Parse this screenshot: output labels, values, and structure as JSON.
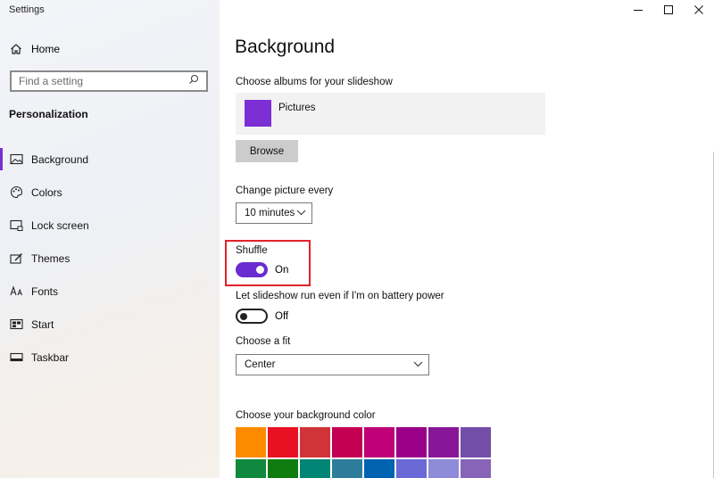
{
  "window": {
    "title": "Settings"
  },
  "sidebar": {
    "home_label": "Home",
    "search_placeholder": "Find a setting",
    "section": "Personalization",
    "items": [
      {
        "label": "Background",
        "icon": "image-icon",
        "active": true
      },
      {
        "label": "Colors",
        "icon": "palette-icon"
      },
      {
        "label": "Lock screen",
        "icon": "lock-screen-icon"
      },
      {
        "label": "Themes",
        "icon": "themes-icon"
      },
      {
        "label": "Fonts",
        "icon": "fonts-icon"
      },
      {
        "label": "Start",
        "icon": "start-icon"
      },
      {
        "label": "Taskbar",
        "icon": "taskbar-icon"
      }
    ]
  },
  "main": {
    "title": "Background",
    "albums_label": "Choose albums for your slideshow",
    "album_name": "Pictures",
    "browse_label": "Browse",
    "interval_label": "Change picture every",
    "interval_value": "10 minutes",
    "shuffle_label": "Shuffle",
    "shuffle_state": "On",
    "battery_label": "Let slideshow run even if I'm on battery power",
    "battery_state": "Off",
    "fit_label": "Choose a fit",
    "fit_value": "Center",
    "color_label": "Choose your background color"
  },
  "colors": {
    "accent": "#6a2ccf",
    "highlight": "#e0222b",
    "swatches": [
      "#ff8c00",
      "#e81123",
      "#d13438",
      "#c30052",
      "#bf0077",
      "#9a0089",
      "#881798",
      "#744da9",
      "#10893e",
      "#107c10",
      "#018574",
      "#2d7d9a",
      "#0063b1",
      "#6b69d6",
      "#8e8cd8",
      "#8764b8"
    ]
  }
}
